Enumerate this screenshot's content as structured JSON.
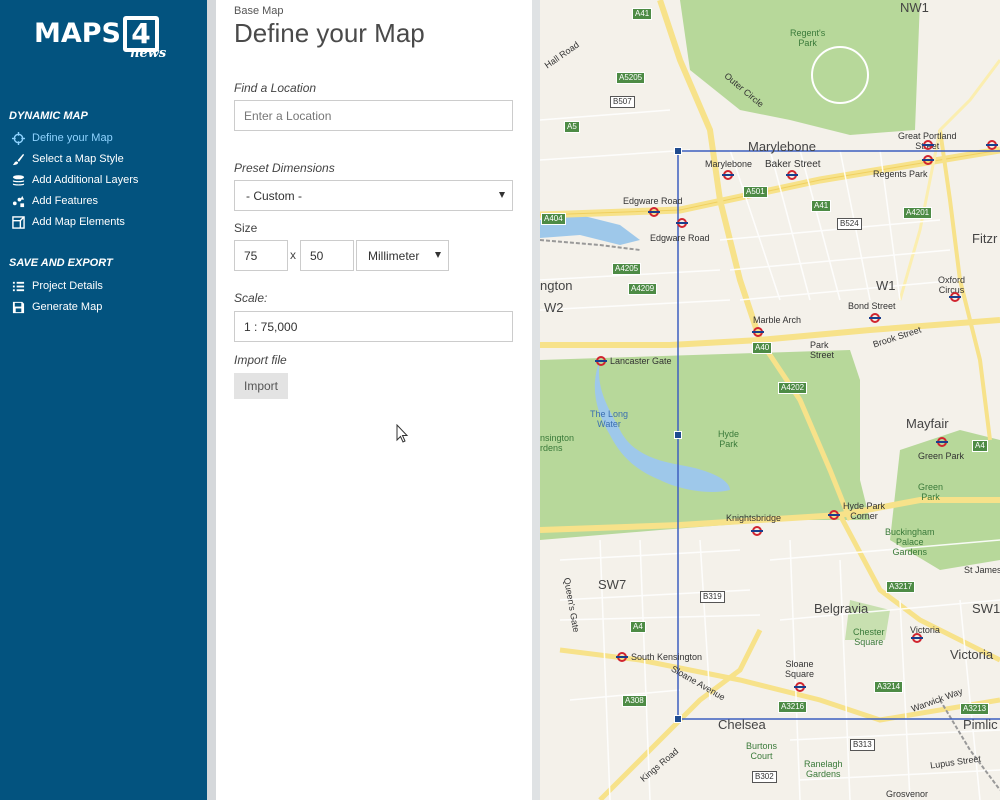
{
  "brand": {
    "logo_text": "MAPS",
    "logo_four": "4",
    "logo_news": "news"
  },
  "nav": {
    "sections": [
      {
        "title": "DYNAMIC MAP",
        "items": [
          {
            "label": "Define your Map",
            "icon": "crosshair-icon",
            "active": true
          },
          {
            "label": "Select a Map Style",
            "icon": "brush-icon"
          },
          {
            "label": "Add Additional Layers",
            "icon": "layers-icon"
          },
          {
            "label": "Add Features",
            "icon": "features-icon"
          },
          {
            "label": "Add Map Elements",
            "icon": "elements-icon"
          }
        ]
      },
      {
        "title": "SAVE AND EXPORT",
        "items": [
          {
            "label": "Project Details",
            "icon": "list-icon"
          },
          {
            "label": "Generate Map",
            "icon": "save-icon"
          }
        ]
      }
    ]
  },
  "panel": {
    "breadcrumb": "Base Map",
    "title": "Define your Map",
    "find_location_label": "Find a Location",
    "find_location_placeholder": "Enter a Location",
    "preset_label": "Preset Dimensions",
    "preset_value": "- Custom -",
    "size_label": "Size",
    "size_width": "75",
    "size_x": "x",
    "size_height": "50",
    "size_unit": "Millimeter",
    "scale_label": "Scale:",
    "scale_value": "1 : 75,000",
    "import_label": "Import file",
    "import_button": "Import"
  },
  "map": {
    "labels": {
      "nw1": "NW1",
      "regents_park": "Regent's\nPark",
      "marylebone": "Marylebone",
      "marylebone_st": "Marylebone",
      "baker_street": "Baker Street",
      "great_portland": "Great Portland\nStreet",
      "regents_park_st": "Regents Park",
      "edgware_road1": "Edgware Road",
      "edgware_road2": "Edgware Road",
      "w2": "W2",
      "ngton": "ngton",
      "w1": "W1",
      "oxford_circus": "Oxford\nCircus",
      "bond_street": "Bond Street",
      "marble_arch": "Marble Arch",
      "lancaster_gate": "Lancaster Gate",
      "long_water": "The Long\nWater",
      "hyde_park": "Hyde\nPark",
      "mayfair": "Mayfair",
      "green_park": "Green Park",
      "green_park2": "Green\nPark",
      "knightsbridge": "Knightsbridge",
      "hyde_park_corner": "Hyde Park\nCorner",
      "buckingham": "Buckingham\nPalace\nGardens",
      "sw7": "SW7",
      "belgravia": "Belgravia",
      "chester_square": "Chester\nSquare",
      "victoria_st": "Victoria",
      "victoria": "Victoria",
      "sw1": "SW1",
      "st_james": "St James",
      "south_kensington": "South Kensington",
      "sloane_square": "Sloane\nSquare",
      "chelsea": "Chelsea",
      "pimlico": "Pimlic",
      "burtons_court": "Burtons\nCourt",
      "ranelagh": "Ranelagh\nGardens",
      "fitzr": "Fitzr",
      "nsington": "nsington\nrdens",
      "hall_road": "Hall Road",
      "kings_road": "Kings Road",
      "sloane_avenue": "Sloane Avenue",
      "queens_gate": "Queen's Gate",
      "warwick_way": "Warwick Way",
      "lupus_street": "Lupus Street",
      "grosvenor": "Grosvenor",
      "outer_circle": "Outer Circle",
      "brook_street": "Brook Street",
      "park_street": "Park\nStreet"
    },
    "badges": [
      "A41",
      "A5205",
      "B507",
      "A5",
      "A501",
      "A41",
      "B524",
      "A4201",
      "A404",
      "A4205",
      "A4209",
      "A40",
      "A4202",
      "A4",
      "B319",
      "A3217",
      "A4",
      "A308",
      "A3216",
      "A3214",
      "A3213",
      "B313",
      "B302"
    ]
  }
}
